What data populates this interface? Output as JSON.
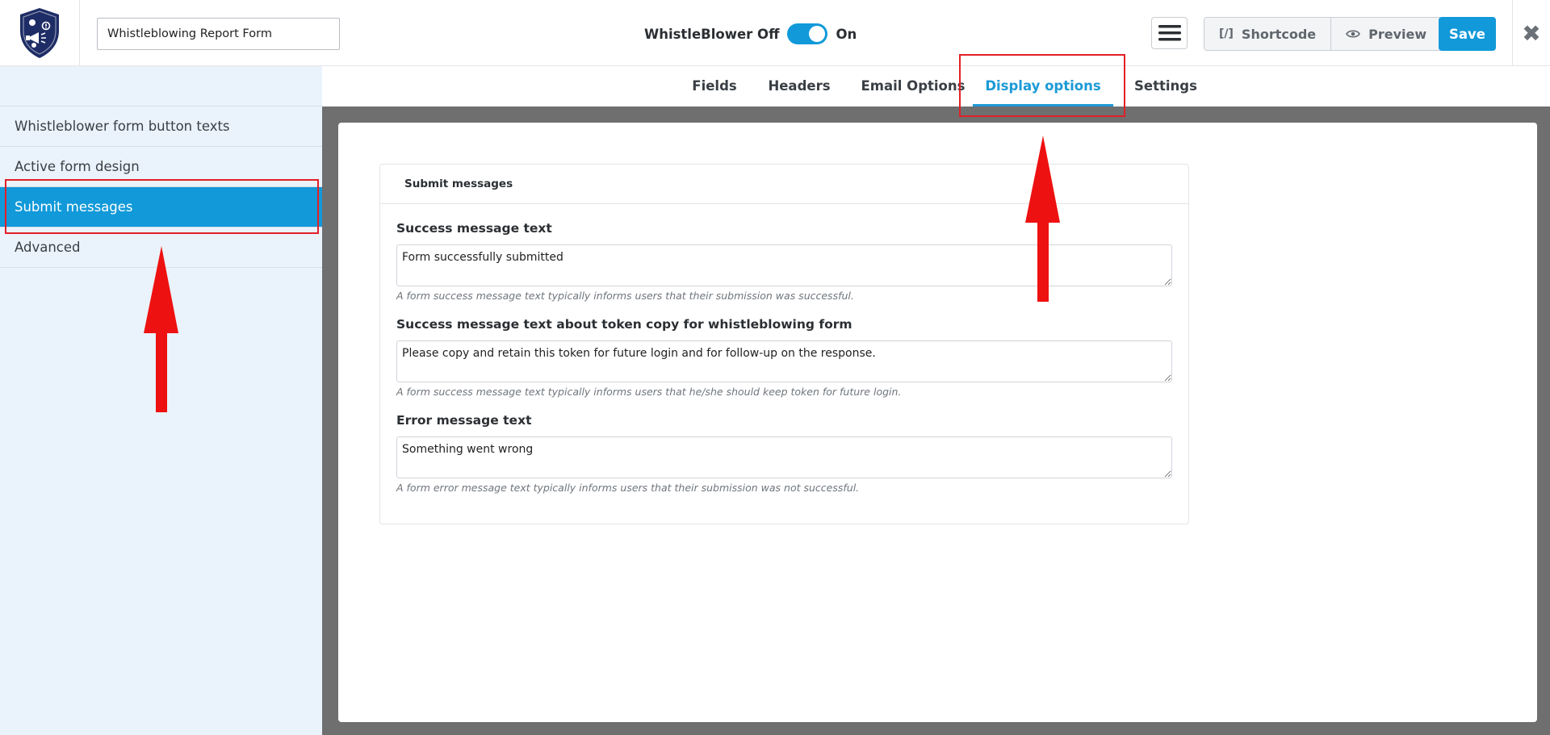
{
  "header": {
    "form_name_value": "Whistleblowing Report Form",
    "toggle_off_label": "WhistleBlower Off",
    "toggle_on_label": "On",
    "toggle_state": "on",
    "shortcode_label": "Shortcode",
    "shortcode_icon_glyph": "[/]",
    "preview_label": "Preview",
    "save_label": "Save",
    "close_glyph": "✖"
  },
  "sidebar": {
    "items": [
      {
        "label": "Whistleblower form button texts",
        "active": false
      },
      {
        "label": "Active form design",
        "active": false
      },
      {
        "label": "Submit messages",
        "active": true
      },
      {
        "label": "Advanced",
        "active": false
      }
    ]
  },
  "tabs": [
    {
      "label": "Fields",
      "active": false
    },
    {
      "label": "Headers",
      "active": false
    },
    {
      "label": "Email Options",
      "active": false
    },
    {
      "label": "Display options",
      "active": true
    },
    {
      "label": "Settings",
      "active": false
    }
  ],
  "card": {
    "title": "Submit messages",
    "fields": [
      {
        "label": "Success message text",
        "value": "Form successfully submitted",
        "help": "A form success message text typically informs users that their submission was successful."
      },
      {
        "label": "Success message text about token copy for whistleblowing form",
        "value": "Please copy and retain this token for future login and for follow-up on the response.",
        "help": "A form success message text typically informs users that he/she should keep token for future login."
      },
      {
        "label": "Error message text",
        "value": "Something went wrong",
        "help": "A form error message text typically informs users that their submission was not successful."
      }
    ]
  },
  "colors": {
    "accent": "#1199d9",
    "annotation_red": "#e21f26",
    "sidebar_bg": "#eaf2fb",
    "main_bg": "#6f6f6f"
  }
}
